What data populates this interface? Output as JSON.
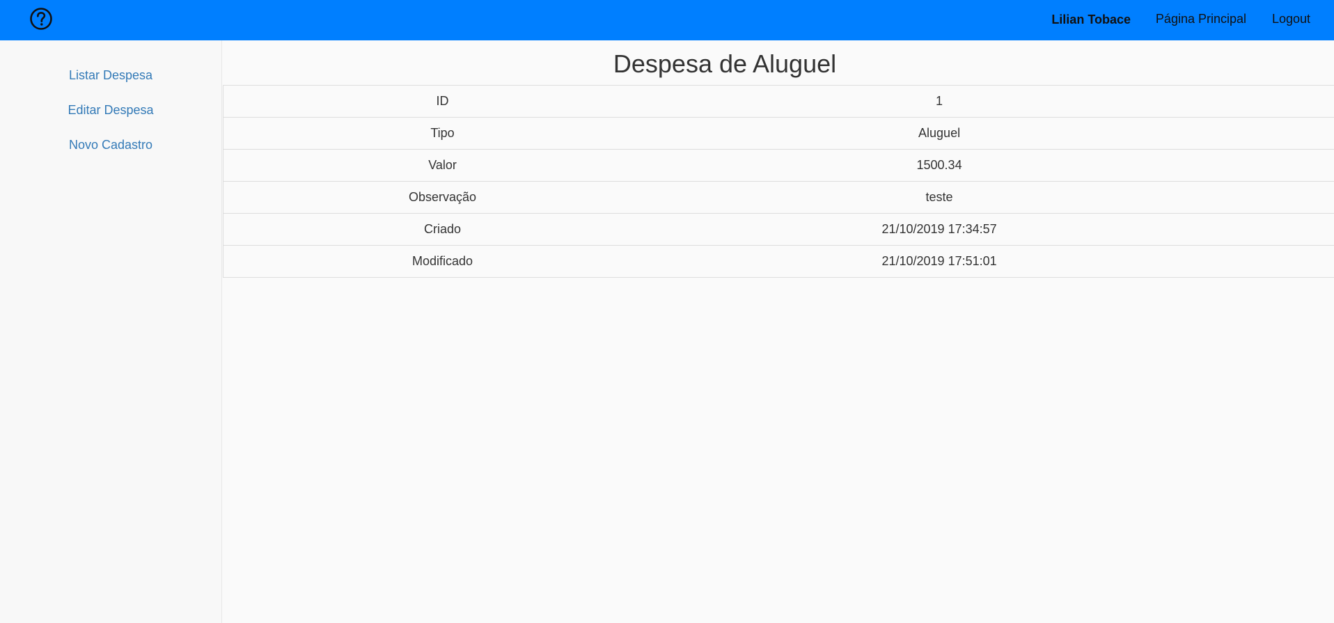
{
  "header": {
    "help_icon": "question-circle-icon",
    "user_name": "Lilian Tobace",
    "home_label": "Página Principal",
    "logout_label": "Logout",
    "bar_color": "#007fff"
  },
  "sidebar": {
    "items": [
      {
        "label": "Listar Despesa"
      },
      {
        "label": "Editar Despesa"
      },
      {
        "label": "Novo Cadastro"
      }
    ],
    "link_color": "#337ab7"
  },
  "main": {
    "title": "Despesa de Aluguel",
    "rows": [
      {
        "label": "ID",
        "value": "1"
      },
      {
        "label": "Tipo",
        "value": "Aluguel"
      },
      {
        "label": "Valor",
        "value": "1500.34"
      },
      {
        "label": "Observação",
        "value": "teste"
      },
      {
        "label": "Criado",
        "value": "21/10/2019 17:34:57"
      },
      {
        "label": "Modificado",
        "value": "21/10/2019 17:51:01"
      }
    ]
  }
}
